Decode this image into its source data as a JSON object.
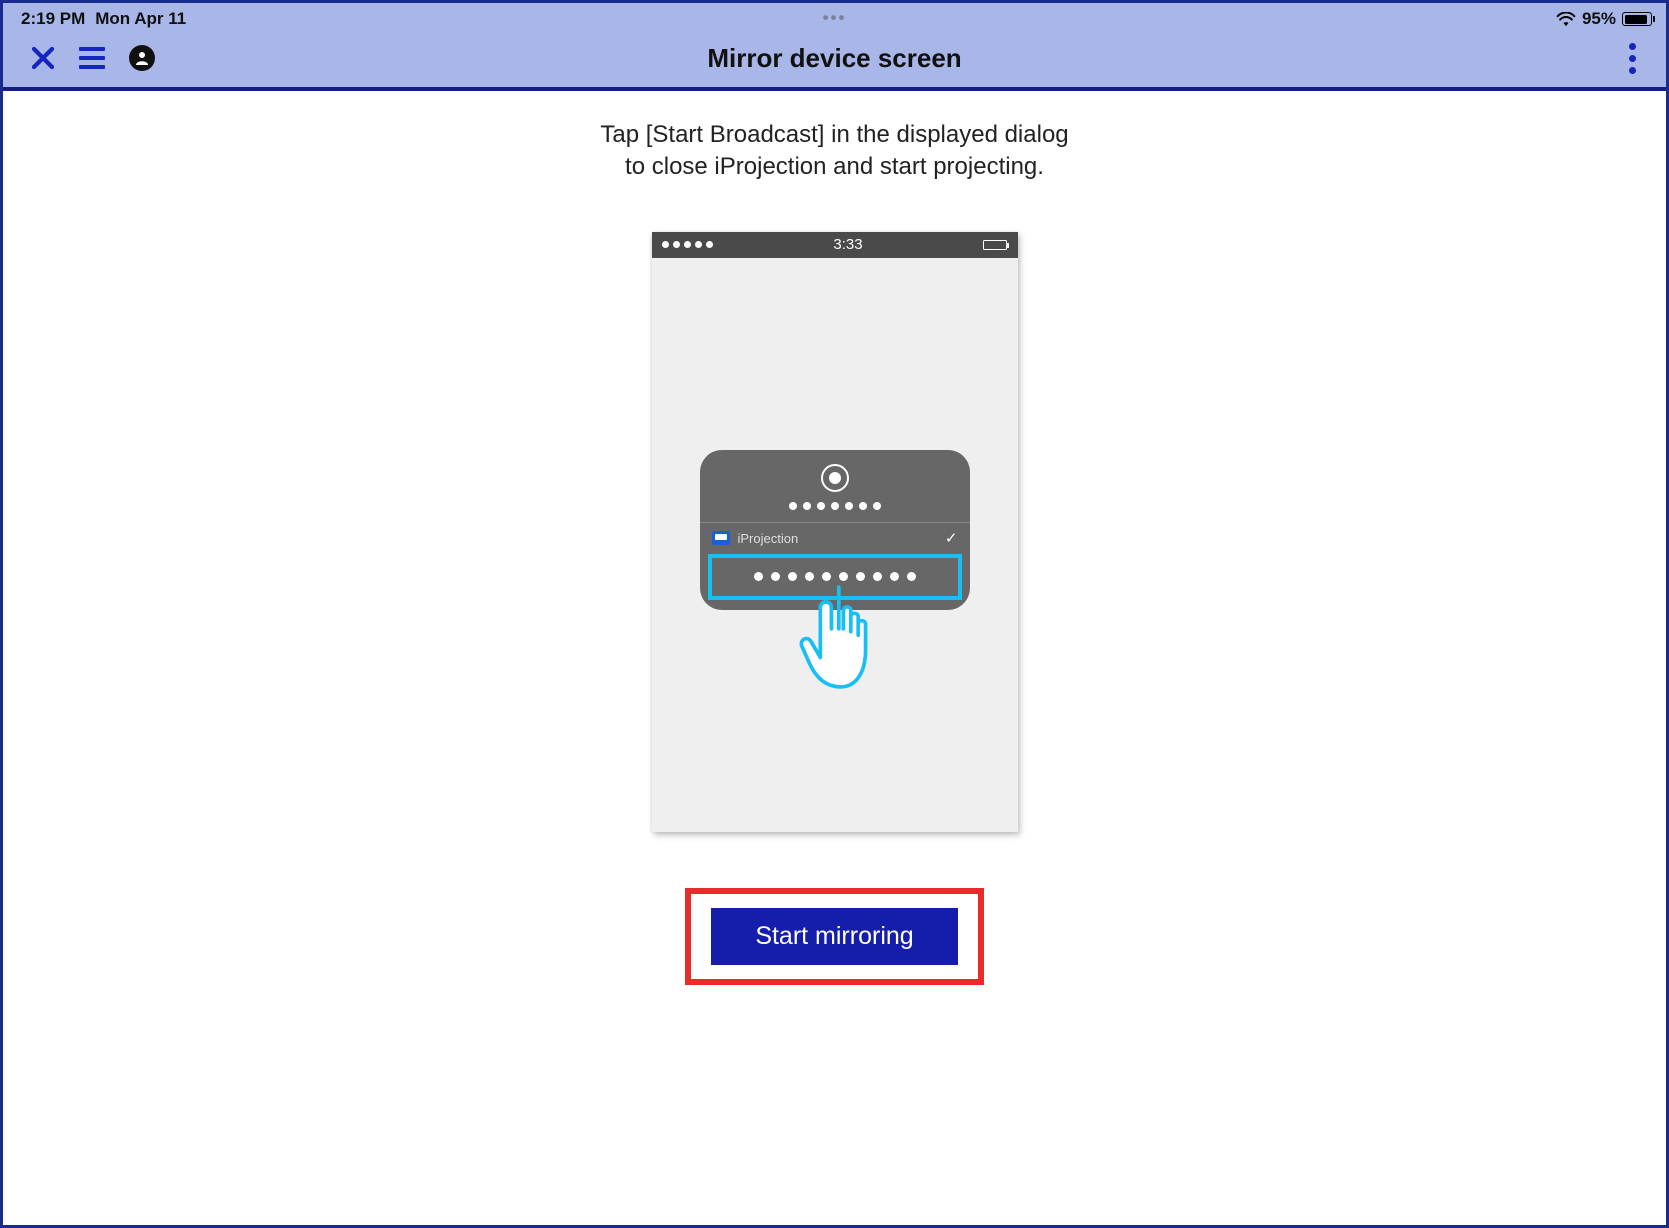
{
  "statusbar": {
    "time": "2:19 PM",
    "date": "Mon Apr 11",
    "handle": "•••",
    "battery_percent": "95%"
  },
  "navbar": {
    "title": "Mirror device screen"
  },
  "content": {
    "instruction_line1": "Tap [Start Broadcast] in the displayed dialog",
    "instruction_line2": "to close iProjection and start projecting."
  },
  "illustration": {
    "phone_time": "3:33",
    "app_row_label": "iProjection"
  },
  "action": {
    "start_label": "Start mirroring"
  }
}
